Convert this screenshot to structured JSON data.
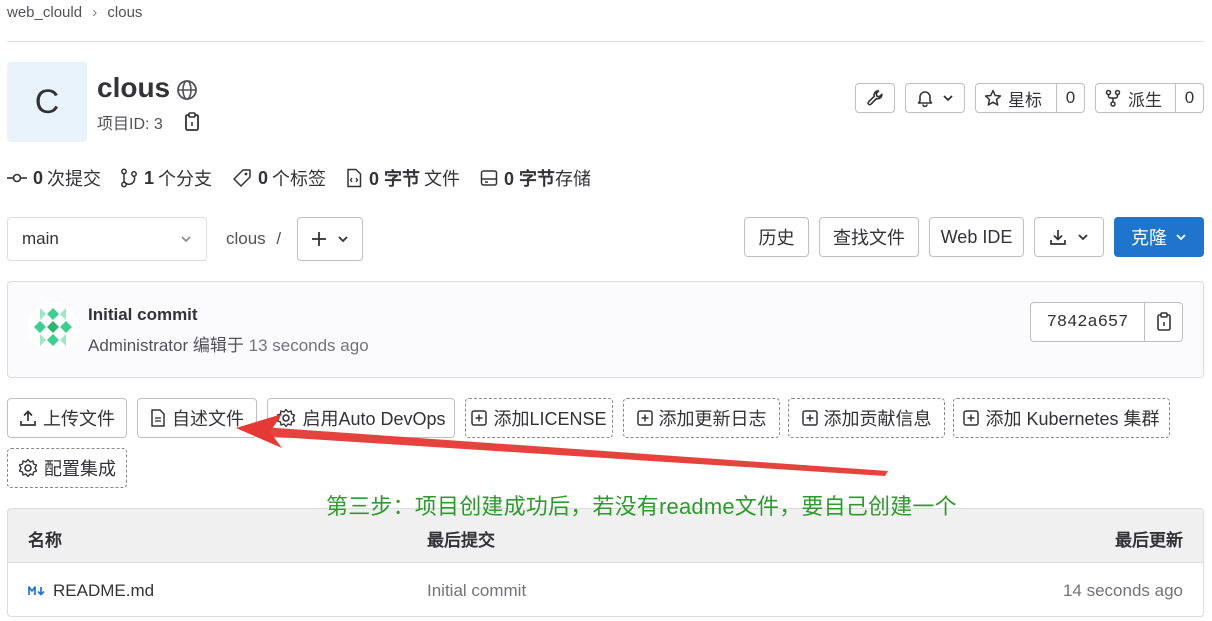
{
  "breadcrumb": {
    "group": "web_clould",
    "separator": "›",
    "project": "clous"
  },
  "project": {
    "avatar_letter": "C",
    "name": "clous",
    "id_label": "项目ID: 3"
  },
  "header_actions": {
    "star_label": "星标",
    "star_count": "0",
    "fork_label": "派生",
    "fork_count": "0"
  },
  "stats": [
    {
      "icon": "commit-icon",
      "count": "0",
      "label": "次提交"
    },
    {
      "icon": "branch-icon",
      "count": "1",
      "label": "个分支"
    },
    {
      "icon": "tag-icon",
      "count": "0",
      "label": "个标签"
    },
    {
      "icon": "file-icon",
      "count": "0 字节",
      "label": "文件"
    },
    {
      "icon": "storage-icon",
      "count": "0 字节",
      "label": "存储"
    }
  ],
  "toolbar": {
    "branch": "main",
    "path": "clous",
    "path_sep": "/",
    "history": "历史",
    "find_file": "查找文件",
    "web_ide": "Web IDE",
    "clone": "克隆"
  },
  "last_commit": {
    "title": "Initial commit",
    "author": "Administrator",
    "action": "编辑于",
    "time": "13 seconds ago",
    "sha": "7842a657"
  },
  "quick_actions": {
    "upload": "上传文件",
    "readme": "自述文件",
    "autodevops": "启用Auto DevOps",
    "license": "添加LICENSE",
    "changelog": "添加更新日志",
    "contributing": "添加贡献信息",
    "kubernetes": "添加 Kubernetes 集群",
    "integrations": "配置集成"
  },
  "annotation": {
    "text": "第三步：项目创建成功后，若没有readme文件，要自己创建一个",
    "color": "#2e9a2e",
    "arrow_color": "#e53935"
  },
  "file_table": {
    "headers": {
      "name": "名称",
      "last_commit": "最后提交",
      "last_update": "最后更新"
    },
    "rows": [
      {
        "name": "README.md",
        "commit": "Initial commit",
        "updated": "14 seconds ago"
      }
    ]
  },
  "colors": {
    "primary": "#1f75cb",
    "avatar_bg": "#e9f3fc"
  }
}
